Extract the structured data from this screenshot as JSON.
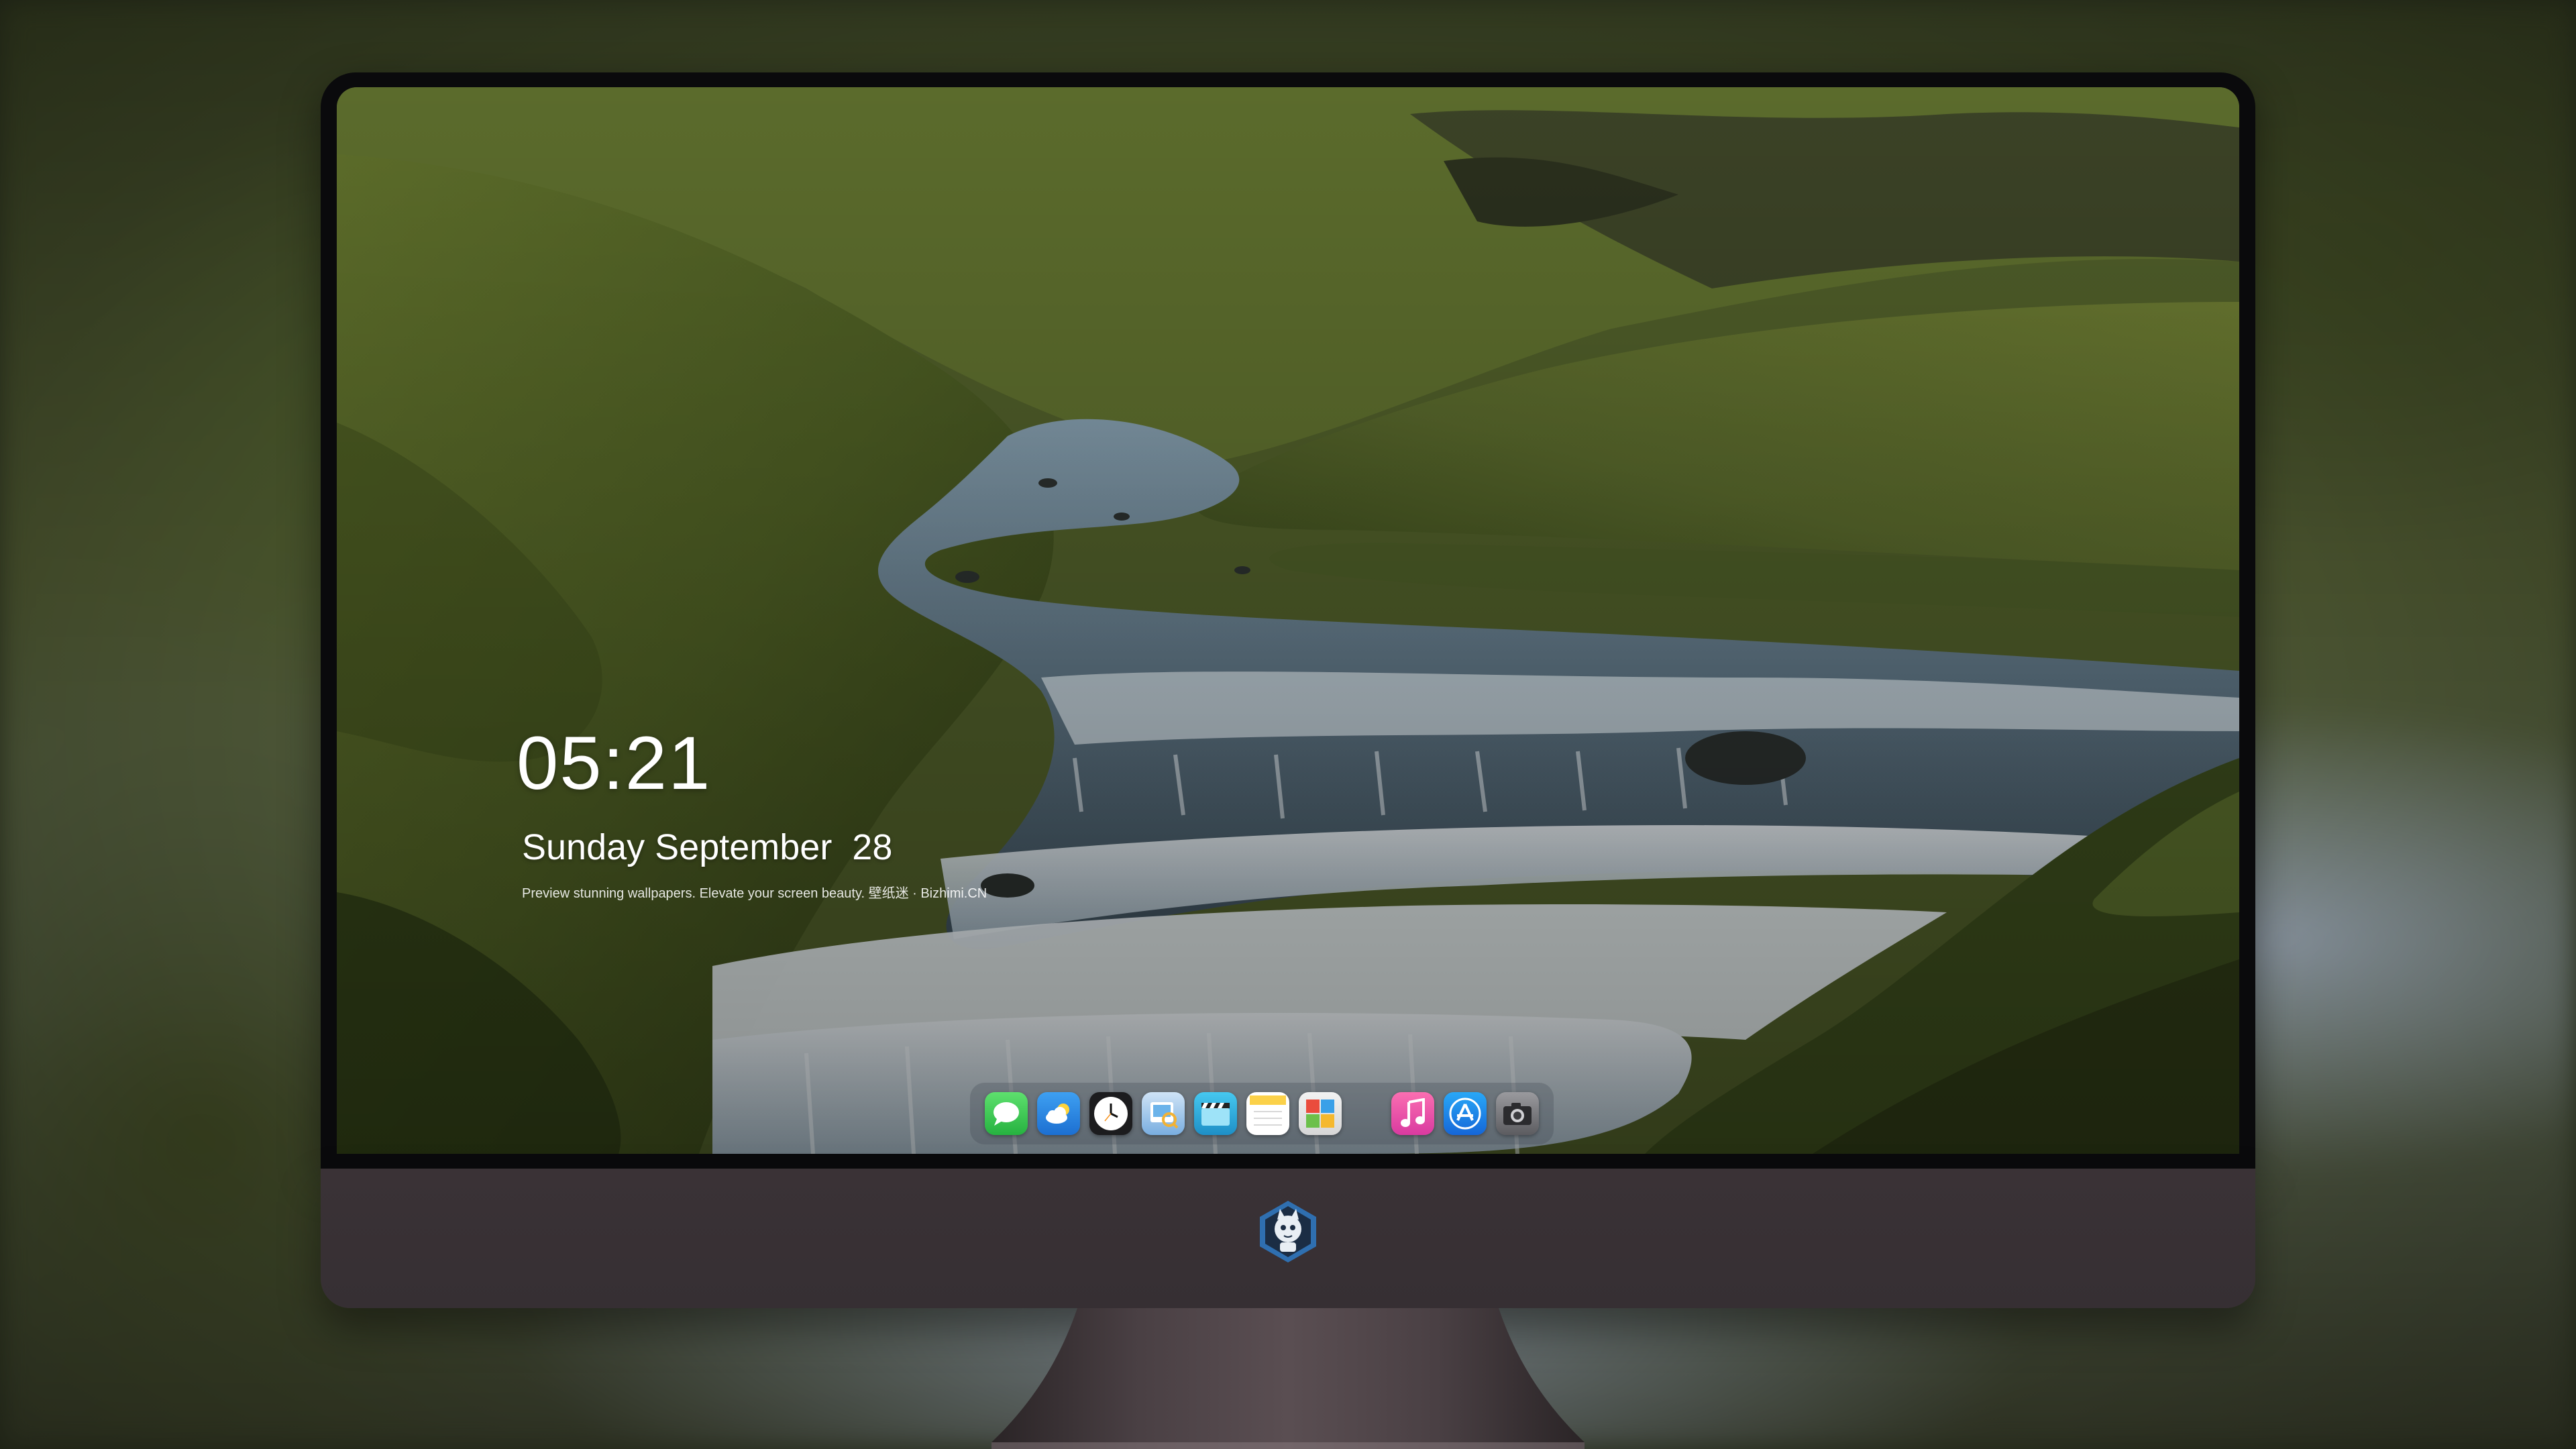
{
  "lock_screen": {
    "time": "05:21",
    "date": "Sunday September  28",
    "tagline": "Preview stunning wallpapers. Elevate your screen beauty. 壁纸迷 · Bizhimi.CN"
  },
  "dock": {
    "apps": [
      {
        "icon": "messages-icon",
        "color": "#34c759"
      },
      {
        "icon": "weather-icon",
        "color": "#2f8be6"
      },
      {
        "icon": "clock-icon",
        "color": "#1c1c1e"
      },
      {
        "icon": "preview-icon",
        "color": "#3b8fe0"
      },
      {
        "icon": "clips-icon",
        "color": "#2ea9d8"
      },
      {
        "icon": "notes-icon",
        "color": "#fbd149"
      },
      {
        "icon": "photo-booth-icon",
        "color": "#e9473d"
      },
      {
        "icon": "music-icon",
        "color": "#f55a9a"
      },
      {
        "icon": "app-store-icon",
        "color": "#1d8cf0"
      },
      {
        "icon": "camera-icon",
        "color": "#7a7a7e"
      }
    ]
  },
  "device": {
    "model": "iMac",
    "chin_logo": "mascot-logo"
  }
}
